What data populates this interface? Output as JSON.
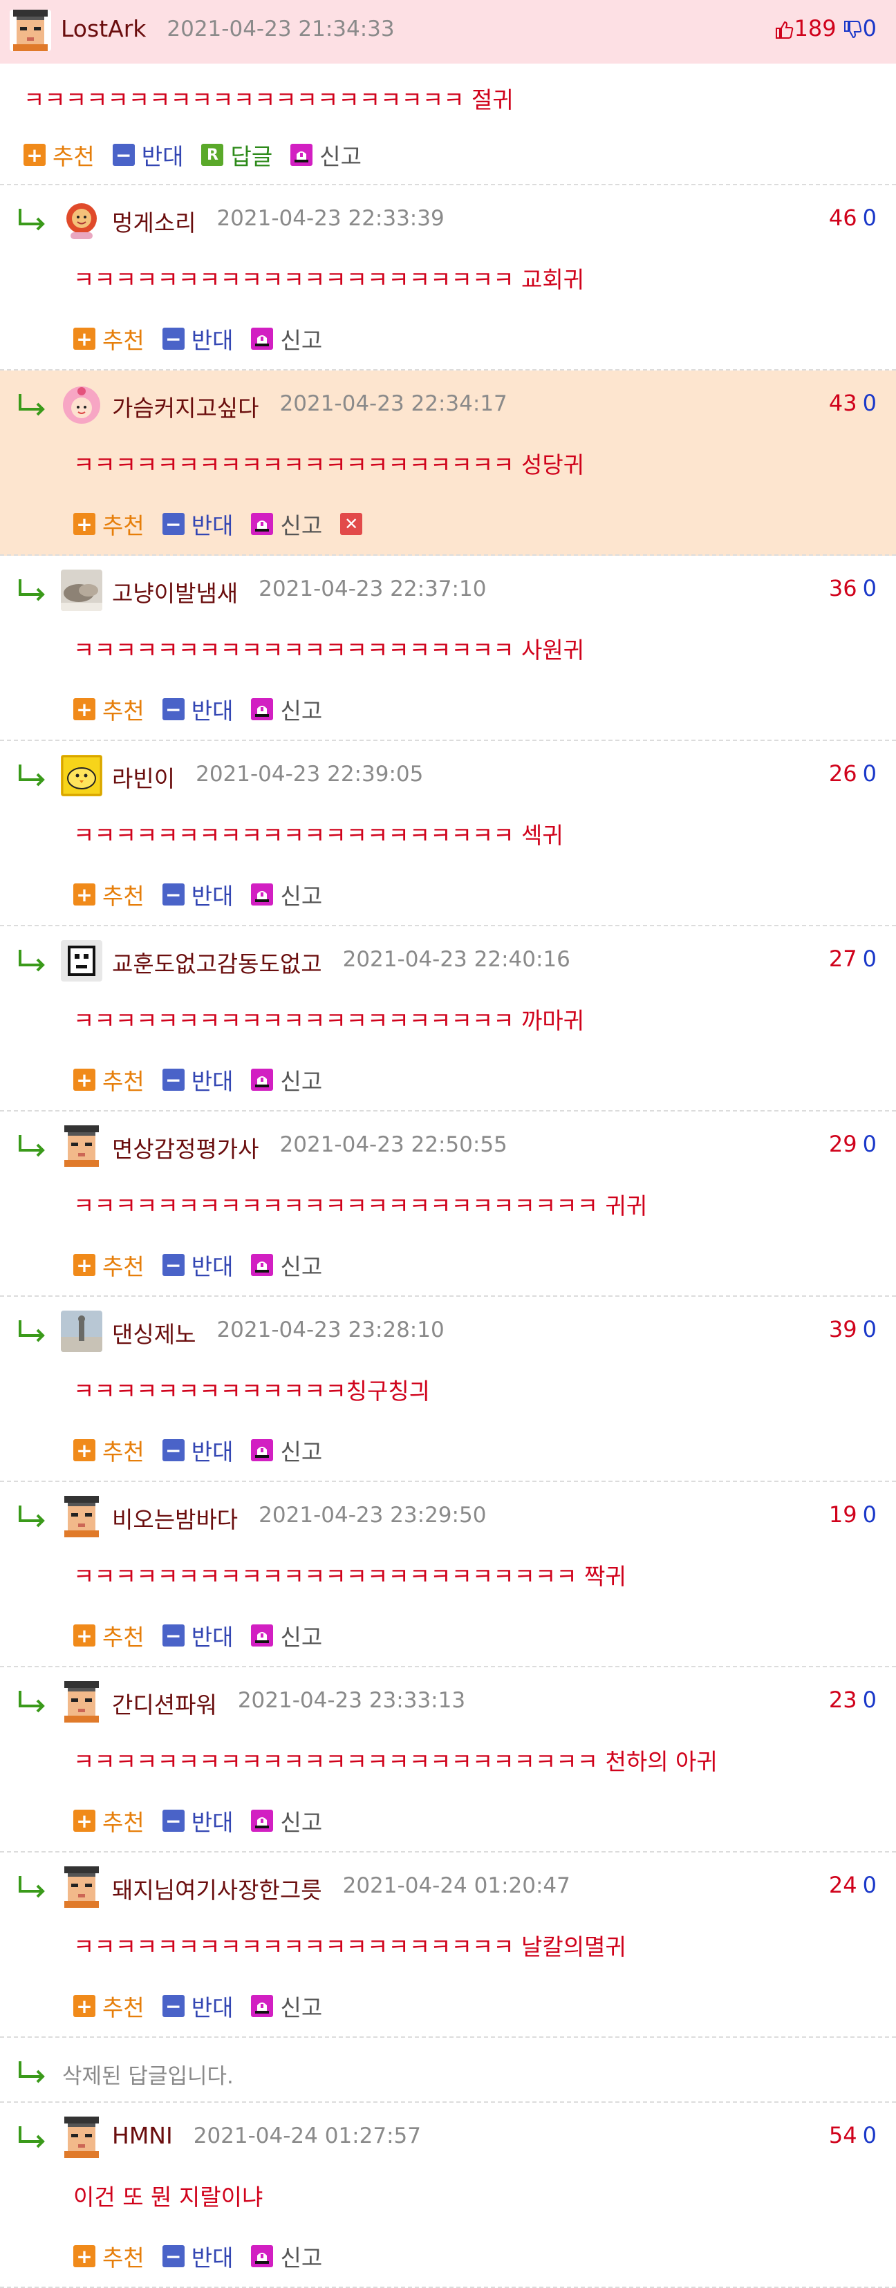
{
  "labels": {
    "recommend": "추천",
    "oppose": "반대",
    "reply": "답글",
    "report": "신고"
  },
  "colors": {
    "main_bg": "#fde0e4",
    "highlight_bg": "#fde5cf",
    "up_vote": "#d0021b",
    "down_vote": "#1a38c9",
    "comment_text": "#d0021b"
  },
  "comments": [
    {
      "kind": "main",
      "nick": "LostArk",
      "date": "2021-04-23 21:34:33",
      "up": "189",
      "down": "0",
      "text": "ㅋㅋㅋㅋㅋㅋㅋㅋㅋㅋㅋㅋㅋㅋㅋㅋㅋㅋㅋㅋㅋ 절귀",
      "avatar": "pixel-man"
    },
    {
      "kind": "reply",
      "nick": "멍게소리",
      "date": "2021-04-23 22:33:39",
      "up": "46",
      "down": "0",
      "text": "ㅋㅋㅋㅋㅋㅋㅋㅋㅋㅋㅋㅋㅋㅋㅋㅋㅋㅋㅋㅋㅋ 교회귀",
      "avatar": "red-flower"
    },
    {
      "kind": "reply",
      "nick": "가슴커지고싶다",
      "date": "2021-04-23 22:34:17",
      "up": "43",
      "down": "0",
      "text": "ㅋㅋㅋㅋㅋㅋㅋㅋㅋㅋㅋㅋㅋㅋㅋㅋㅋㅋㅋㅋㅋ 성당귀",
      "avatar": "pink-girl",
      "highlight": true,
      "deletable": true
    },
    {
      "kind": "reply",
      "nick": "고냥이발냄새",
      "date": "2021-04-23 22:37:10",
      "up": "36",
      "down": "0",
      "text": "ㅋㅋㅋㅋㅋㅋㅋㅋㅋㅋㅋㅋㅋㅋㅋㅋㅋㅋㅋㅋㅋ 사원귀",
      "avatar": "cat-photo"
    },
    {
      "kind": "reply",
      "nick": "라빈이",
      "date": "2021-04-23 22:39:05",
      "up": "26",
      "down": "0",
      "text": "ㅋㅋㅋㅋㅋㅋㅋㅋㅋㅋㅋㅋㅋㅋㅋㅋㅋㅋㅋㅋㅋ 섹귀",
      "avatar": "yellow-chick"
    },
    {
      "kind": "reply",
      "nick": "교훈도없고감동도없고",
      "date": "2021-04-23 22:40:16",
      "up": "27",
      "down": "0",
      "text": "ㅋㅋㅋㅋㅋㅋㅋㅋㅋㅋㅋㅋㅋㅋㅋㅋㅋㅋㅋㅋㅋ 까마귀",
      "avatar": "bw-char"
    },
    {
      "kind": "reply",
      "nick": "면상감정평가사",
      "date": "2021-04-23 22:50:55",
      "up": "29",
      "down": "0",
      "text": "ㅋㅋㅋㅋㅋㅋㅋㅋㅋㅋㅋㅋㅋㅋㅋㅋㅋㅋㅋㅋㅋㅋㅋㅋㅋ 귀귀",
      "avatar": "pixel-man"
    },
    {
      "kind": "reply",
      "nick": "댄싱제노",
      "date": "2021-04-23 23:28:10",
      "up": "39",
      "down": "0",
      "text": "ㅋㅋㅋㅋㅋㅋㅋㅋㅋㅋㅋㅋㅋ칭구칭긔",
      "avatar": "statue-photo"
    },
    {
      "kind": "reply",
      "nick": "비오는밤바다",
      "date": "2021-04-23 23:29:50",
      "up": "19",
      "down": "0",
      "text": "ㅋㅋㅋㅋㅋㅋㅋㅋㅋㅋㅋㅋㅋㅋㅋㅋㅋㅋㅋㅋㅋㅋㅋㅋ 짝귀",
      "avatar": "pixel-man"
    },
    {
      "kind": "reply",
      "nick": "간디션파워",
      "date": "2021-04-23 23:33:13",
      "up": "23",
      "down": "0",
      "text": "ㅋㅋㅋㅋㅋㅋㅋㅋㅋㅋㅋㅋㅋㅋㅋㅋㅋㅋㅋㅋㅋㅋㅋㅋㅋ 천하의 아귀",
      "avatar": "pixel-man"
    },
    {
      "kind": "reply",
      "nick": "돼지님여기사장한그릇",
      "date": "2021-04-24 01:20:47",
      "up": "24",
      "down": "0",
      "text": "ㅋㅋㅋㅋㅋㅋㅋㅋㅋㅋㅋㅋㅋㅋㅋㅋㅋㅋㅋㅋㅋ 날칼의멸귀",
      "avatar": "pixel-man"
    },
    {
      "kind": "deleted",
      "text": "삭제된 답글입니다."
    },
    {
      "kind": "reply",
      "nick": "HMNI",
      "date": "2021-04-24 01:27:57",
      "up": "54",
      "down": "0",
      "text": "이건 또 뭔 지랄이냐",
      "avatar": "pixel-man"
    }
  ]
}
